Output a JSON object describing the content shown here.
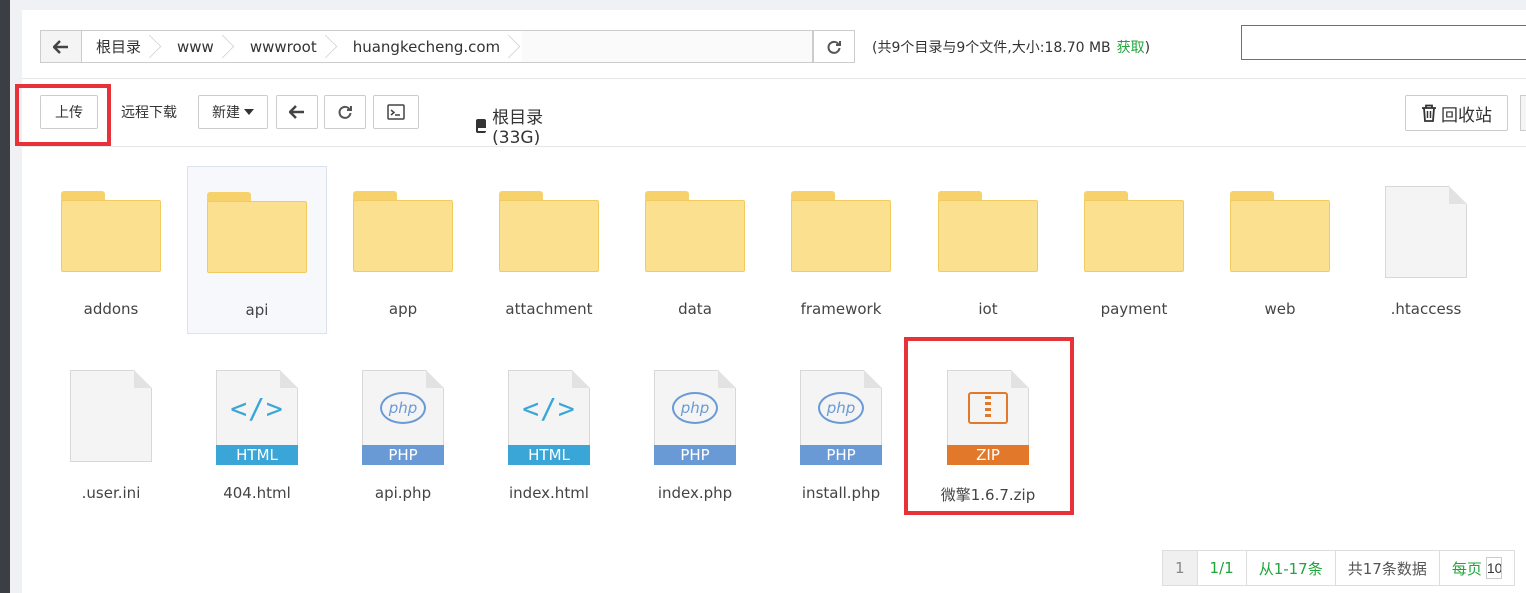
{
  "path": {
    "crumbs": [
      "根目录",
      "www",
      "wwwroot",
      "huangkecheng.com"
    ],
    "info": "(共9个目录与9个文件,大小:18.70 MB",
    "info_close": ")",
    "get_label": "获取",
    "search_value": ""
  },
  "toolbar": {
    "upload": "上传",
    "remote_download": "远程下载",
    "new": "新建",
    "disk_label": "根目录(33G)",
    "recycle": "回收站"
  },
  "files": [
    {
      "name": "addons",
      "type": "folder"
    },
    {
      "name": "api",
      "type": "folder",
      "selected": true
    },
    {
      "name": "app",
      "type": "folder"
    },
    {
      "name": "attachment",
      "type": "folder"
    },
    {
      "name": "data",
      "type": "folder"
    },
    {
      "name": "framework",
      "type": "folder"
    },
    {
      "name": "iot",
      "type": "folder"
    },
    {
      "name": "payment",
      "type": "folder"
    },
    {
      "name": "web",
      "type": "folder"
    },
    {
      "name": ".htaccess",
      "type": "file"
    },
    {
      "name": ".user.ini",
      "type": "file"
    },
    {
      "name": "404.html",
      "type": "html",
      "badge": "HTML"
    },
    {
      "name": "api.php",
      "type": "php",
      "badge": "PHP"
    },
    {
      "name": "index.html",
      "type": "html",
      "badge": "HTML"
    },
    {
      "name": "index.php",
      "type": "php",
      "badge": "PHP"
    },
    {
      "name": "install.php",
      "type": "php",
      "badge": "PHP"
    },
    {
      "name": "微擎1.6.7.zip",
      "type": "zip",
      "badge": "ZIP"
    }
  ],
  "icon_glyphs": {
    "html": "</>",
    "php": "php"
  },
  "pagination": {
    "current": "1",
    "pages": "1/1",
    "range": "从1-17条",
    "total": "共17条数据",
    "per_page_label": "每页",
    "per_page_value": "10"
  },
  "colors": {
    "accent": "#20a53a",
    "highlight": "#e8323a",
    "folder": "#fbe08f"
  }
}
